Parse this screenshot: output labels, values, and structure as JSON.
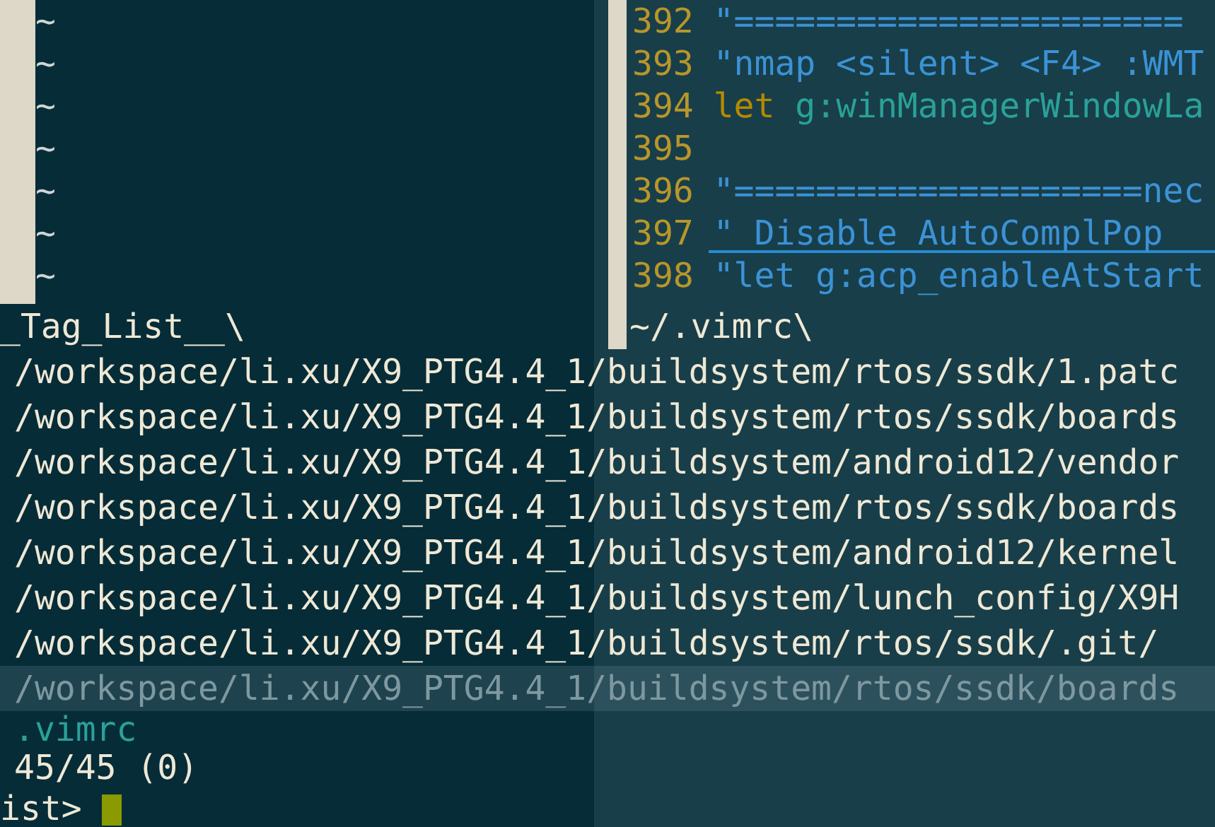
{
  "left_window": {
    "lines": [
      "~",
      "~",
      "~",
      "~",
      "~",
      "~",
      "~"
    ]
  },
  "right_window": {
    "lines": [
      {
        "number": "392",
        "cursorline": false,
        "segments": [
          {
            "text": "\"======================",
            "kind": "comment"
          }
        ]
      },
      {
        "number": "393",
        "cursorline": false,
        "segments": [
          {
            "text": "\"nmap <silent> <F4> :WMT",
            "kind": "comment"
          }
        ]
      },
      {
        "number": "394",
        "cursorline": false,
        "segments": [
          {
            "text": "let",
            "kind": "keyword"
          },
          {
            "text": " g:winManagerWindowLa",
            "kind": "identifier"
          }
        ]
      },
      {
        "number": "395",
        "cursorline": false
      },
      {
        "number": "396",
        "cursorline": false,
        "segments": [
          {
            "text": "\"====================nec",
            "kind": "comment"
          }
        ]
      },
      {
        "number": "397",
        "cursorline": true,
        "segments": [
          {
            "text": "\" Disable AutoComplPop",
            "kind": "comment"
          }
        ]
      },
      {
        "number": "398",
        "cursorline": false,
        "segments": [
          {
            "text": "\"let g:acp_enableAtStart",
            "kind": "comment"
          }
        ]
      }
    ]
  },
  "status_bars": [
    {
      "text": "_Tag_List__\\"
    },
    {
      "text": "~/.vimrc\\"
    }
  ],
  "results": [
    {
      "text": "/workspace/li.xu/X9_PTG4.4_1/buildsystem/rtos/ssdk/1.patc",
      "selected": false
    },
    {
      "text": "/workspace/li.xu/X9_PTG4.4_1/buildsystem/rtos/ssdk/boards",
      "selected": false
    },
    {
      "text": "/workspace/li.xu/X9_PTG4.4_1/buildsystem/android12/vendor",
      "selected": false
    },
    {
      "text": "/workspace/li.xu/X9_PTG4.4_1/buildsystem/rtos/ssdk/boards",
      "selected": false
    },
    {
      "text": "/workspace/li.xu/X9_PTG4.4_1/buildsystem/android12/kernel",
      "selected": false
    },
    {
      "text": "/workspace/li.xu/X9_PTG4.4_1/buildsystem/lunch_config/X9H",
      "selected": false
    },
    {
      "text": "/workspace/li.xu/X9_PTG4.4_1/buildsystem/rtos/ssdk/.git/",
      "selected": false
    },
    {
      "text": "/workspace/li.xu/X9_PTG4.4_1/buildsystem/rtos/ssdk/boards",
      "selected": true
    }
  ],
  "filename": ".vimrc",
  "count": "45/45 (0)",
  "prompt": "ist>"
}
